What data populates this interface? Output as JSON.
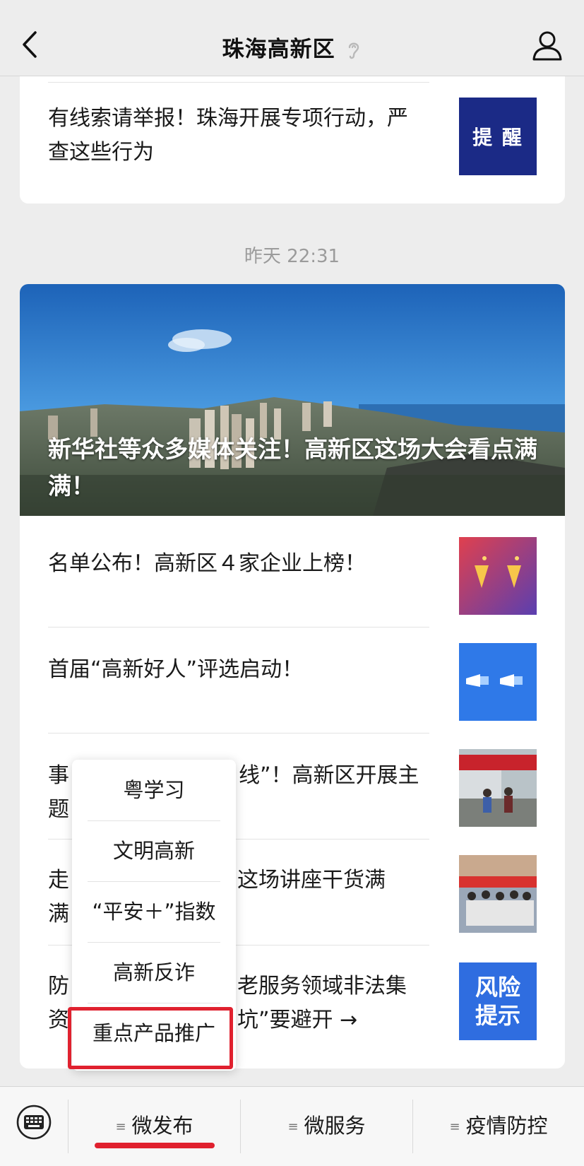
{
  "header": {
    "title": "珠海高新区",
    "back_icon": "chevron-left-icon",
    "listen_icon": "ear-icon",
    "profile_icon": "person-icon"
  },
  "top_card": {
    "title": "有线索请举报！珠海开展专项行动，严查这些行为",
    "thumb_text": "提 醒",
    "thumb_color": "#1b2a86"
  },
  "timestamp": "昨天 22:31",
  "hero": {
    "title": "新华社等众多媒体关注！高新区这场大会看点满满！"
  },
  "articles": [
    {
      "title": "名单公布！高新区４家企业上榜！",
      "thumb": "party-popper-thumbnail"
    },
    {
      "title": "首届“高新好人”评选启动！",
      "thumb": "megaphone-thumbnail"
    },
    {
      "title": "事……线”！高新区开展主题……",
      "title_visible_a": "事",
      "title_visible_b": "线”！高新区开展主",
      "title_visible_c": "题",
      "thumb": "event-photo-thumbnail"
    },
    {
      "title_visible_a": "走",
      "title_visible_b": "这场讲座干货满满！",
      "thumb": "group-photo-thumbnail"
    },
    {
      "title_visible_a": "防",
      "title_visible_b": "老服务领域非法集",
      "title_visible_c": "资",
      "title_visible_d": "坑”要避开 →",
      "thumb_text_1": "风险",
      "thumb_text_2": "提示",
      "thumb_color": "#2f6de0"
    }
  ],
  "popup_menu": {
    "items": [
      "粤学习",
      "文明高新",
      "“平安＋”指数",
      "高新反诈",
      "重点产品推广"
    ],
    "highlighted_index": 4,
    "highlight_color": "#e0212f"
  },
  "bottom_bar": {
    "keyboard_icon": "keyboard-icon",
    "menu_lines": "≡",
    "tabs": [
      "微发布",
      "微服务",
      "疫情防控"
    ],
    "active_index": 0
  }
}
